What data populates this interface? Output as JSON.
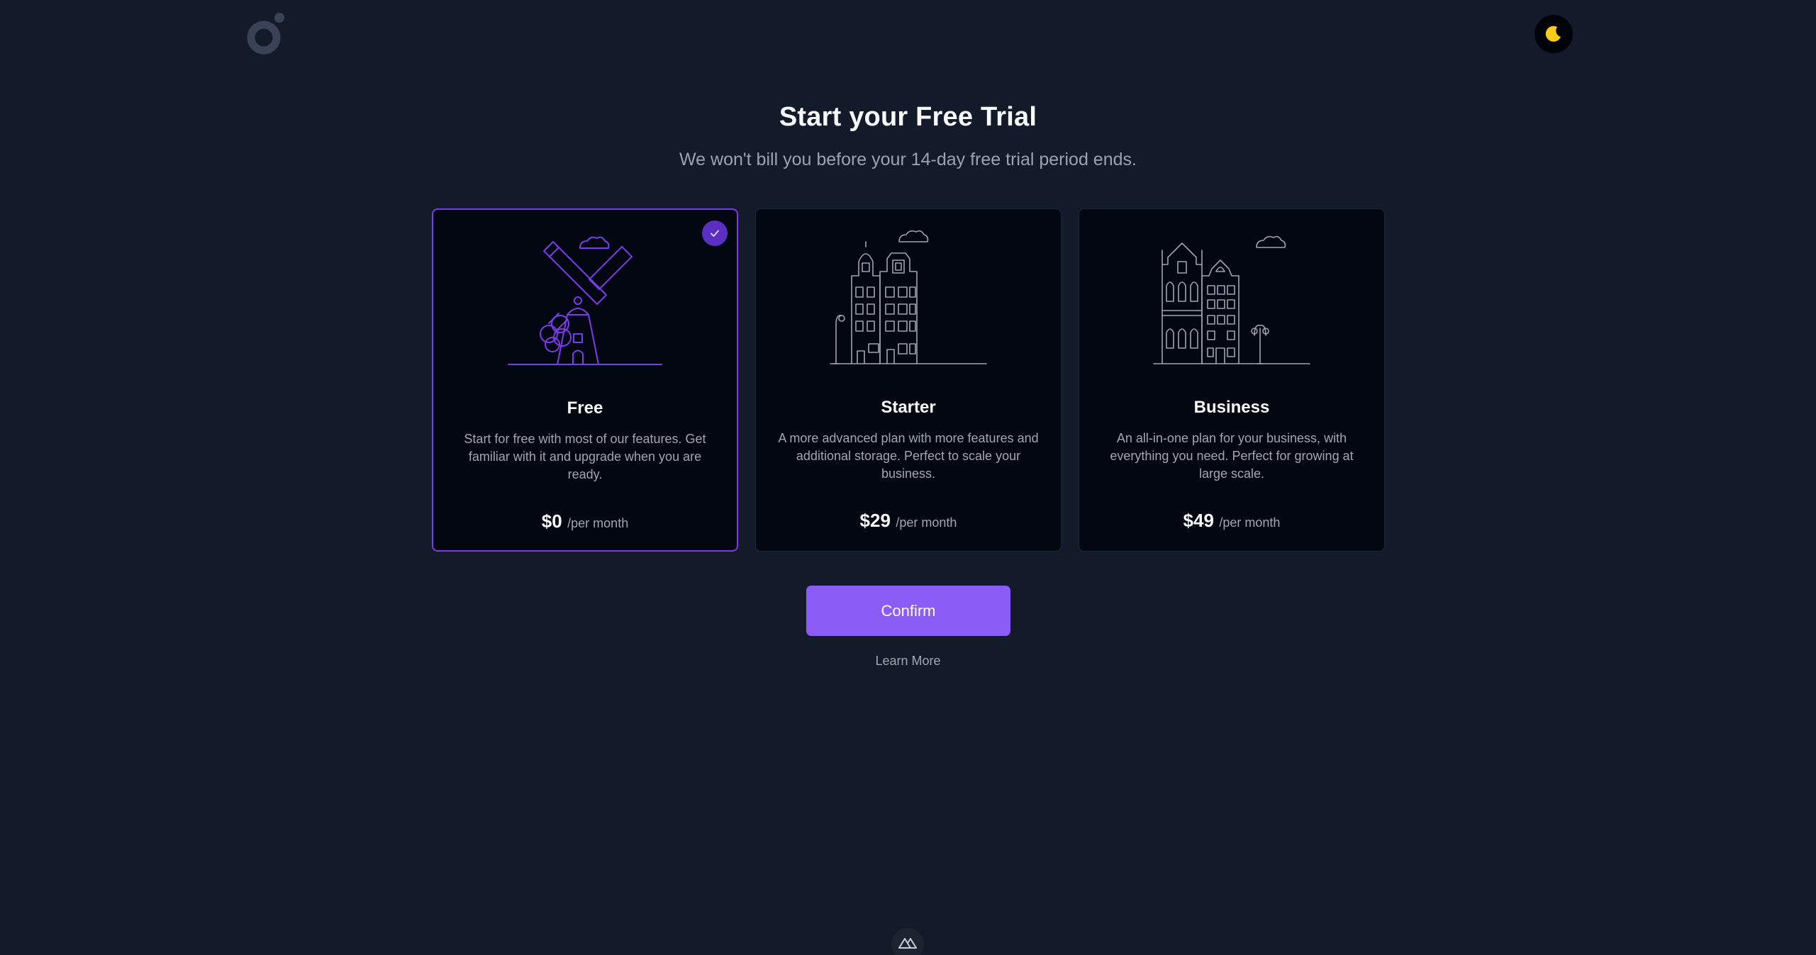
{
  "header": {
    "logo_icon": "brand-logo-icon",
    "theme_toggle_icon": "moon-icon"
  },
  "hero": {
    "title": "Start your Free Trial",
    "subtitle": "We won't bill you before your 14-day free trial period ends."
  },
  "plans": [
    {
      "name": "Free",
      "description": "Start for free with most of our features. Get familiar with it and upgrade when you are ready.",
      "price": "$0",
      "period": "/per month",
      "selected": true,
      "illustration": "windmill-illustration"
    },
    {
      "name": "Starter",
      "description": "A more advanced plan with more features and additional storage. Perfect to scale your business.",
      "price": "$29",
      "period": "/per month",
      "selected": false,
      "illustration": "townhouses-illustration"
    },
    {
      "name": "Business",
      "description": "An all-in-one plan for your business, with everything you need. Perfect for growing at large scale.",
      "price": "$49",
      "period": "/per month",
      "selected": false,
      "illustration": "buildings-illustration"
    }
  ],
  "actions": {
    "confirm_label": "Confirm",
    "learn_more_label": "Learn More"
  },
  "colors": {
    "background": "#131a2a",
    "card_background": "#030712",
    "accent": "#8b5cf6",
    "selected_border": "#7c3aed",
    "moon": "#facc15"
  },
  "footer": {
    "badge_icon": "nuxt-logo-icon"
  }
}
